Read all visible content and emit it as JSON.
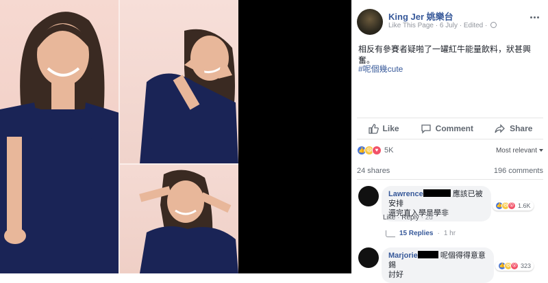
{
  "post": {
    "author": "King Jer 姚樂台",
    "like_page": "Like This Page",
    "date": "6 July",
    "edited": "Edited",
    "text": "相反有參賽者疑啪了一罐紅牛能量飲料，狀甚興奮。",
    "hashtag": "#呢個幾cute"
  },
  "actions": {
    "like": "Like",
    "comment": "Comment",
    "share": "Share"
  },
  "reactions": {
    "count": "5K",
    "sort": "Most relevant",
    "shares": "24 shares",
    "comments": "196 comments"
  },
  "comments": [
    {
      "name": "Lawrence",
      "text_line1": "應該已被安排",
      "text_line2": "還完直入學是學非",
      "reaction_count": "1.6K",
      "like": "Like",
      "reply": "Reply",
      "time": "2d",
      "replies": "15 Replies",
      "replies_time": "1 hr"
    },
    {
      "name": "Marjorie",
      "text_line1": "呢個得得意意錫",
      "text_line2": "討好",
      "reaction_count": "323"
    }
  ],
  "colors": {
    "link": "#365899",
    "meta": "#90949c",
    "like_blue": "#4a76d8",
    "haha_yellow": "#f7c744",
    "love_red": "#f25268"
  }
}
